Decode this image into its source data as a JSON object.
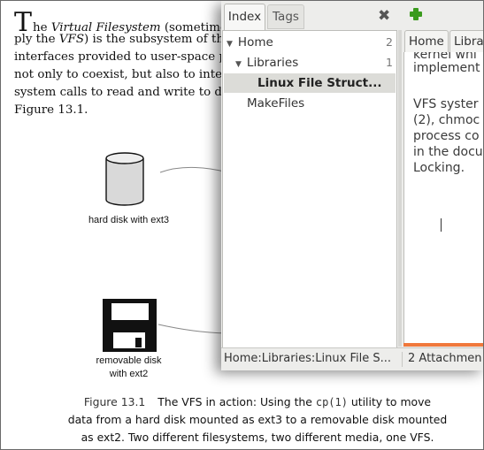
{
  "book": {
    "dropcap": "T",
    "lines": [
      {
        "a": "he ",
        "i": "Virtual Filesystem",
        "b": " (sometimes"
      },
      {
        "a": "ply the ",
        "i": "VFS",
        "b": ") is the subsystem of the"
      },
      {
        "a": "interfaces provided to user-space pro",
        "i": "",
        "b": ""
      },
      {
        "a": "not only to coexist, but also to inter",
        "i": "",
        "b": ""
      },
      {
        "a": "system calls to read and write to diff",
        "i": "",
        "b": ""
      },
      {
        "a": "Figure 13.1.",
        "i": "",
        "b": ""
      }
    ],
    "hard_disk_label": "hard disk with ext3",
    "floppy_label_1": "removable disk",
    "floppy_label_2": "with ext2",
    "caption": {
      "number": "Figure 13.1",
      "line1_pre": "The VFS in action: Using the ",
      "code": "cp(1)",
      "line1_post": " utility to move",
      "line2": "data from a hard disk mounted as ext3 to a removable disk mounted",
      "line3": "as ext2. Two different filesystems, two different media, one VFS."
    }
  },
  "window": {
    "tabs": [
      {
        "label": "Index",
        "active": true
      },
      {
        "label": "Tags",
        "active": false
      }
    ],
    "close_glyph": "✖",
    "tree": [
      {
        "label": "Home",
        "count": "2",
        "expanded": true
      },
      {
        "label": "Libraries",
        "count": "1",
        "expanded": true
      },
      {
        "label": "Linux File Struct...",
        "selected": true
      },
      {
        "label": "MakeFiles"
      }
    ],
    "editor_tabs": [
      "Home",
      "Libra"
    ],
    "editor_lines": [
      "kernel whi",
      "implement",
      "",
      "VFS syster",
      "(2), chmoc",
      "process co",
      "in the docu",
      "Locking."
    ],
    "status_path": "Home:Libraries:Linux File S...",
    "status_attachments": "2 Attachmen",
    "colors": {
      "accent_bar": "#f0783c",
      "add_icon": "#3a9b1d"
    }
  }
}
